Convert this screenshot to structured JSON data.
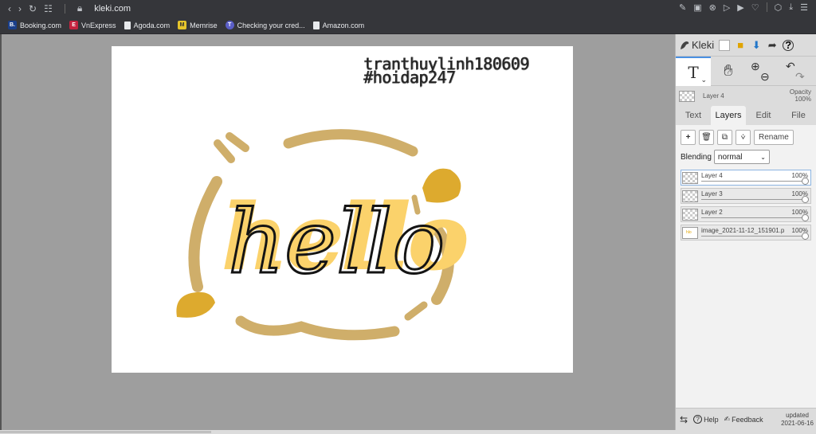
{
  "browser": {
    "url": "kleki.com",
    "bookmarks": [
      {
        "label": "Booking.com",
        "icon": "B."
      },
      {
        "label": "VnExpress",
        "icon": "E"
      },
      {
        "label": "Agoda.com",
        "icon": ""
      },
      {
        "label": "Memrise",
        "icon": "M"
      },
      {
        "label": "Checking your cred...",
        "icon": "T"
      },
      {
        "label": "Amazon.com",
        "icon": ""
      }
    ]
  },
  "canvas": {
    "text_line1": "tranthuylinh180609",
    "text_line2": "#hoidap247",
    "art_word": "hello",
    "colors": {
      "tan": "#cfae6a",
      "gold": "#ddaa2e",
      "yellow": "#fbd26b",
      "ink": "#141414"
    }
  },
  "app": {
    "name": "Kleki",
    "current_layer": "Layer 4",
    "opacity_label": "Opacity",
    "opacity_value": "100%",
    "tabs": [
      "Text",
      "Layers",
      "Edit",
      "File"
    ],
    "active_tab": "Layers",
    "rename_label": "Rename",
    "blending_label": "Blending",
    "blending_value": "normal",
    "layers": [
      {
        "name": "Layer 4",
        "opacity": "100%",
        "active": true
      },
      {
        "name": "Layer 3",
        "opacity": "100%",
        "active": false
      },
      {
        "name": "Layer 2",
        "opacity": "100%",
        "active": false
      },
      {
        "name": "image_2021-11-12_151901.p",
        "opacity": "100%",
        "active": false
      }
    ],
    "footer": {
      "help": "Help",
      "feedback": "Feedback",
      "updated_label": "updated",
      "updated_date": "2021-06-16"
    }
  }
}
